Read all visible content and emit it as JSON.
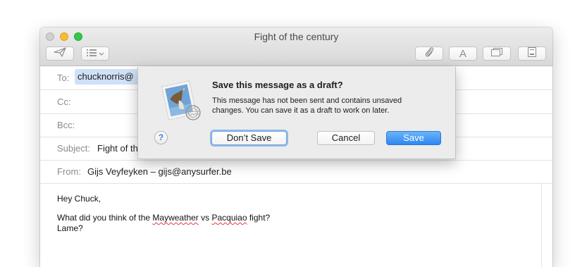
{
  "window": {
    "title": "Fight of the century"
  },
  "toolbar": {
    "icons": [
      "send-icon",
      "format-list-icon",
      "chevron-down-icon",
      "attachment-icon",
      "font-icon",
      "photo-browser-icon",
      "stationery-icon"
    ],
    "font_glyph": "A"
  },
  "header": {
    "to_label": "To:",
    "to_value": "chucknorris@",
    "cc_label": "Cc:",
    "bcc_label": "Bcc:",
    "subject_label": "Subject:",
    "subject_value": "Fight of th",
    "from_label": "From:",
    "from_value": "Gijs Veyfeyken – gijs@anysurfer.be"
  },
  "body": {
    "greeting": "Hey Chuck,",
    "line1_before": "What did you think of the ",
    "line1_word1": "Mayweather",
    "line1_middle": " vs ",
    "line1_word2": "Pacquiao",
    "line1_after": " fight?",
    "line2": "Lame?"
  },
  "dialog": {
    "title": "Save this message as a draft?",
    "message": "This message has not been sent and contains unsaved changes. You can save it as a draft to work on later.",
    "help_label": "?",
    "dont_save_label": "Don’t Save",
    "cancel_label": "Cancel",
    "save_label": "Save",
    "icon": "mail-stamp-eagle-icon"
  },
  "colors": {
    "accent": "#2d87f0",
    "token_bg": "#cfe1f8",
    "label_gray": "#8a8a8a"
  }
}
